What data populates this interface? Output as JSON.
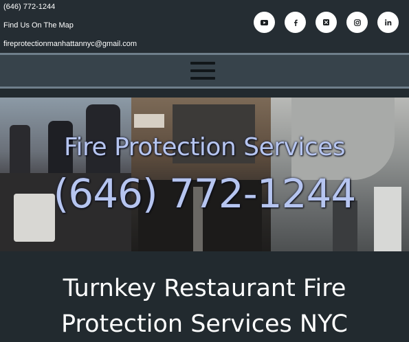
{
  "header": {
    "phone": "(646) 772-1244",
    "map_link": "Find Us On The Map",
    "email": "fireprotectionmanhattannyc@gmail.com"
  },
  "social": [
    {
      "name": "youtube-icon",
      "label": "YouTube"
    },
    {
      "name": "facebook-icon",
      "label": "f"
    },
    {
      "name": "x-twitter-icon",
      "label": "X"
    },
    {
      "name": "instagram-icon",
      "label": "Instagram"
    },
    {
      "name": "linkedin-icon",
      "label": "in"
    }
  ],
  "nav": {
    "menu_icon": "hamburger-menu-icon"
  },
  "hero": {
    "title": "Fire Protection Services",
    "phone": "(646) 772-1244"
  },
  "main": {
    "heading_line1": "Turnkey Restaurant Fire",
    "heading_line2": "Protection Services NYC"
  },
  "colors": {
    "topbar": "#252d33",
    "navbar": "#37434b",
    "divider": "#6f7f8b",
    "page_bg": "#222a2f",
    "hero_text": "#b6c5f0"
  }
}
